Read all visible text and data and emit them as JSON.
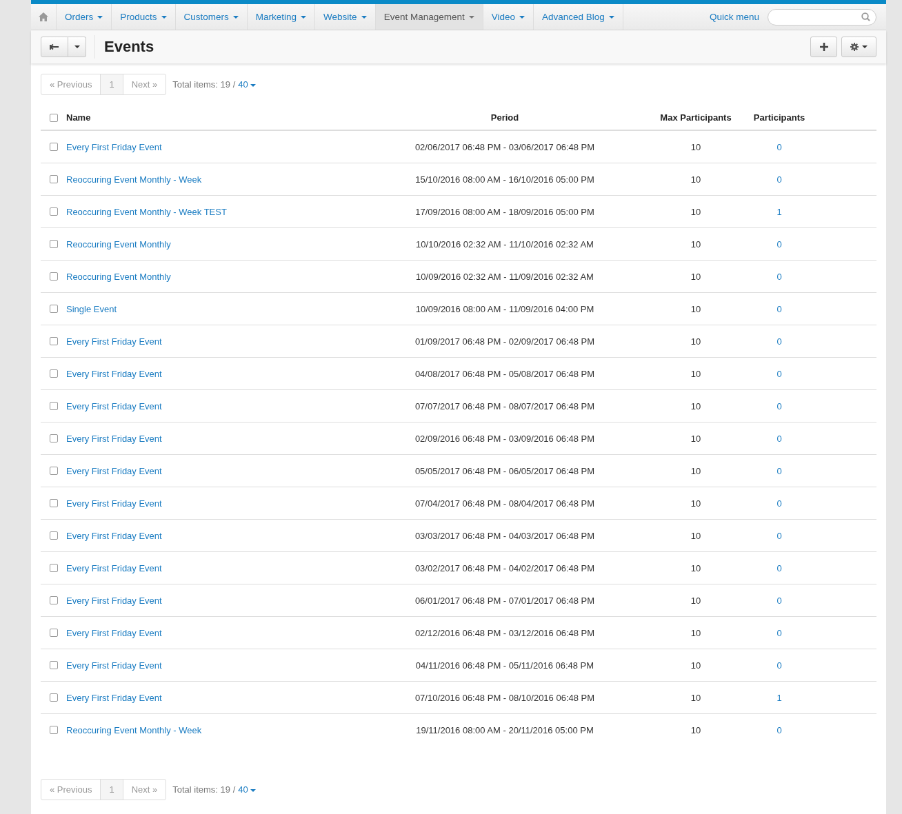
{
  "nav": {
    "items": [
      {
        "label": "Orders",
        "selected": false
      },
      {
        "label": "Products",
        "selected": false
      },
      {
        "label": "Customers",
        "selected": false
      },
      {
        "label": "Marketing",
        "selected": false
      },
      {
        "label": "Website",
        "selected": false
      },
      {
        "label": "Event Management",
        "selected": true
      },
      {
        "label": "Video",
        "selected": false
      },
      {
        "label": "Advanced Blog",
        "selected": false
      }
    ],
    "quick_menu": "Quick menu"
  },
  "page_title": "Events",
  "pagination_top": {
    "previous": {
      "label": "« Previous",
      "disabled": true
    },
    "pages": [
      {
        "label": "1",
        "selected": true
      }
    ],
    "next": {
      "label": "Next »",
      "disabled": true
    },
    "total": "Total items: 19 /",
    "per_page": "40"
  },
  "table": {
    "select_all": {
      "checked": false
    },
    "columns": [
      "Name",
      "Period",
      "Max Participants",
      "Participants"
    ],
    "rows": [
      {
        "checked": false,
        "name": "Every First Friday Event",
        "period": "02/06/2017 06:48 PM - 03/06/2017 06:48 PM",
        "max": "10",
        "participants": "0"
      },
      {
        "checked": false,
        "name": "Reoccuring Event Monthly - Week",
        "period": "15/10/2016 08:00 AM - 16/10/2016 05:00 PM",
        "max": "10",
        "participants": "0"
      },
      {
        "checked": false,
        "name": "Reoccuring Event Monthly - Week TEST",
        "period": "17/09/2016 08:00 AM - 18/09/2016 05:00 PM",
        "max": "10",
        "participants": "1"
      },
      {
        "checked": false,
        "name": "Reoccuring Event Monthly",
        "period": "10/10/2016 02:32 AM - 11/10/2016 02:32 AM",
        "max": "10",
        "participants": "0"
      },
      {
        "checked": false,
        "name": "Reoccuring Event Monthly",
        "period": "10/09/2016 02:32 AM - 11/09/2016 02:32 AM",
        "max": "10",
        "participants": "0"
      },
      {
        "checked": false,
        "name": "Single Event",
        "period": "10/09/2016 08:00 AM - 11/09/2016 04:00 PM",
        "max": "10",
        "participants": "0"
      },
      {
        "checked": false,
        "name": "Every First Friday Event",
        "period": "01/09/2017 06:48 PM - 02/09/2017 06:48 PM",
        "max": "10",
        "participants": "0"
      },
      {
        "checked": false,
        "name": "Every First Friday Event",
        "period": "04/08/2017 06:48 PM - 05/08/2017 06:48 PM",
        "max": "10",
        "participants": "0"
      },
      {
        "checked": false,
        "name": "Every First Friday Event",
        "period": "07/07/2017 06:48 PM - 08/07/2017 06:48 PM",
        "max": "10",
        "participants": "0"
      },
      {
        "checked": false,
        "name": "Every First Friday Event",
        "period": "02/09/2016 06:48 PM - 03/09/2016 06:48 PM",
        "max": "10",
        "participants": "0"
      },
      {
        "checked": false,
        "name": "Every First Friday Event",
        "period": "05/05/2017 06:48 PM - 06/05/2017 06:48 PM",
        "max": "10",
        "participants": "0"
      },
      {
        "checked": false,
        "name": "Every First Friday Event",
        "period": "07/04/2017 06:48 PM - 08/04/2017 06:48 PM",
        "max": "10",
        "participants": "0"
      },
      {
        "checked": false,
        "name": "Every First Friday Event",
        "period": "03/03/2017 06:48 PM - 04/03/2017 06:48 PM",
        "max": "10",
        "participants": "0"
      },
      {
        "checked": false,
        "name": "Every First Friday Event",
        "period": "03/02/2017 06:48 PM - 04/02/2017 06:48 PM",
        "max": "10",
        "participants": "0"
      },
      {
        "checked": false,
        "name": "Every First Friday Event",
        "period": "06/01/2017 06:48 PM - 07/01/2017 06:48 PM",
        "max": "10",
        "participants": "0"
      },
      {
        "checked": false,
        "name": "Every First Friday Event",
        "period": "02/12/2016 06:48 PM - 03/12/2016 06:48 PM",
        "max": "10",
        "participants": "0"
      },
      {
        "checked": false,
        "name": "Every First Friday Event",
        "period": "04/11/2016 06:48 PM - 05/11/2016 06:48 PM",
        "max": "10",
        "participants": "0"
      },
      {
        "checked": false,
        "name": "Every First Friday Event",
        "period": "07/10/2016 06:48 PM - 08/10/2016 06:48 PM",
        "max": "10",
        "participants": "1"
      },
      {
        "checked": false,
        "name": "Reoccuring Event Monthly - Week",
        "period": "19/11/2016 08:00 AM - 20/11/2016 05:00 PM",
        "max": "10",
        "participants": "0"
      }
    ]
  },
  "pagination_bottom": {
    "previous": {
      "label": "« Previous",
      "disabled": true
    },
    "pages": [
      {
        "label": "1",
        "selected": true
      }
    ],
    "next": {
      "label": "Next »",
      "disabled": true
    },
    "total": "Total items: 19 /",
    "per_page": "40"
  }
}
